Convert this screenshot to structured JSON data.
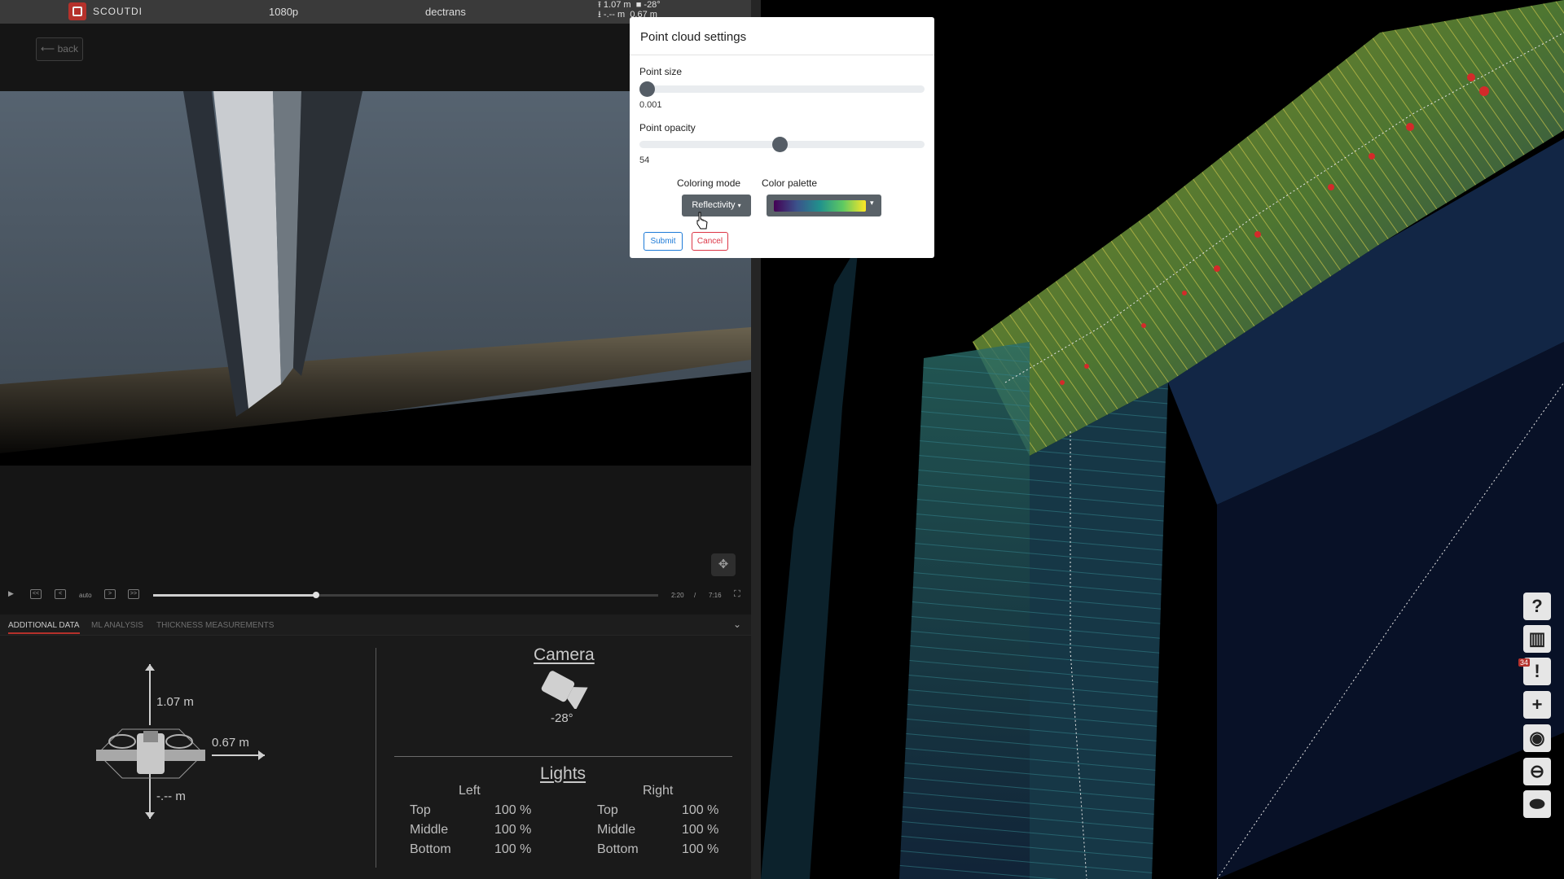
{
  "topbar": {
    "brand": "SCOUTDI",
    "resolution": "1080p",
    "user": "dectrans",
    "altitude_up": "1.07 m",
    "altitude_down": "-.-- m",
    "camera_tilt": "-28°",
    "distance": "0.67 m"
  },
  "back_label": "back",
  "player": {
    "play_icon": "▶",
    "prev_label": "<<",
    "step_back_label": "<",
    "speed_label": "auto",
    "step_fwd_label": ">",
    "next_label": ">>",
    "current_time": "2:20",
    "time_separator": "/",
    "total_time": "7:16",
    "progress": 0.322,
    "buffered": 0.374
  },
  "tabs": [
    {
      "label": "ADDITIONAL DATA"
    },
    {
      "label": "ML ANALYSIS"
    },
    {
      "label": "THICKNESS MEASUREMENTS"
    }
  ],
  "drone": {
    "up_value": "1.07 m",
    "side_value": "0.67 m",
    "down_value": "-.-- m"
  },
  "camera": {
    "title": "Camera",
    "angle": "-28°"
  },
  "lights": {
    "title": "Lights",
    "left_header": "Left",
    "right_header": "Right",
    "rows": [
      {
        "label": "Top",
        "left": "100 %",
        "right": "100 %"
      },
      {
        "label": "Middle",
        "left": "100 %",
        "right": "100 %"
      },
      {
        "label": "Bottom",
        "left": "100 %",
        "right": "100 %"
      }
    ]
  },
  "sidebar_icons": [
    {
      "name": "help-icon",
      "glyph": "?"
    },
    {
      "name": "map-icon",
      "glyph": "▥"
    },
    {
      "name": "alert-icon",
      "glyph": "!"
    },
    {
      "name": "add-icon",
      "glyph": "+"
    },
    {
      "name": "eye-icon",
      "glyph": "◉"
    },
    {
      "name": "minus-icon",
      "glyph": "⊖"
    },
    {
      "name": "toggle-icon",
      "glyph": "⬬"
    }
  ],
  "alert_count": "34",
  "modal": {
    "title": "Point cloud settings",
    "point_size_label": "Point size",
    "point_size_value": "0.001",
    "point_size_fraction": 0.0,
    "point_opacity_label": "Point opacity",
    "point_opacity_value": "54",
    "point_opacity_fraction": 0.49,
    "coloring_mode_label": "Coloring mode",
    "coloring_mode_value": "Reflectivity",
    "color_palette_label": "Color palette",
    "submit_label": "Submit",
    "cancel_label": "Cancel"
  },
  "colors": {
    "brand_red": "#b5312b",
    "submit_blue": "#1e7bd8",
    "cancel_red": "#dc3545",
    "slider_knob": "#555d66"
  }
}
